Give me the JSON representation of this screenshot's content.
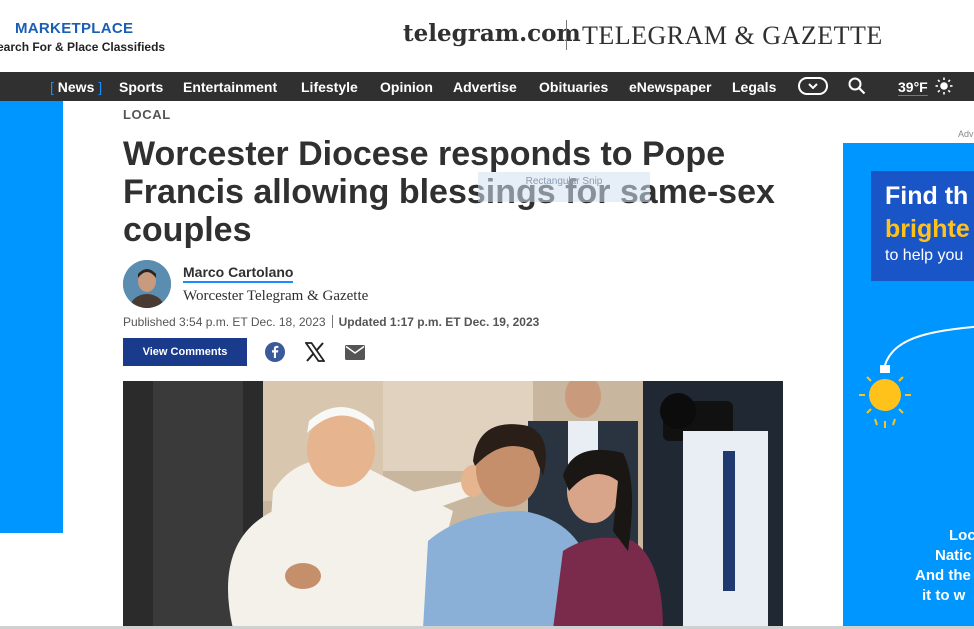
{
  "marketplace": {
    "title": "MARKETPLACE",
    "subtitle": "earch For & Place Classifieds"
  },
  "brand": {
    "site": "telegram.com",
    "paper": "TELEGRAM & GAZETTE"
  },
  "nav": {
    "items": [
      {
        "label": "News",
        "active": true
      },
      {
        "label": "Sports"
      },
      {
        "label": "Entertainment"
      },
      {
        "label": "Lifestyle"
      },
      {
        "label": "Opinion"
      },
      {
        "label": "Advertise"
      },
      {
        "label": "Obituaries"
      },
      {
        "label": "eNewspaper"
      },
      {
        "label": "Legals"
      }
    ],
    "weather": "39°F",
    "accent_color": "#1a8cff",
    "bar_color": "#303030"
  },
  "article": {
    "section": "LOCAL",
    "headline": "Worcester Diocese responds to Pope Francis allowing blessings for same-sex couples",
    "watermark": "Rectangular Snip",
    "author": "Marco Cartolano",
    "organization": "Worcester Telegram & Gazette",
    "published": "Published 3:54 p.m. ET Dec. 18, 2023",
    "updated": "Updated 1:17 p.m. ET Dec. 19, 2023",
    "comments_button": "View Comments",
    "share_icons": [
      "facebook-icon",
      "x-icon",
      "email-icon"
    ],
    "button_color": "#1a3a8c"
  },
  "ad": {
    "label": "Adv",
    "line1": "Find th",
    "line2": "brighte",
    "line3": "to help you",
    "bottom": [
      "Loc",
      "Natic",
      "And the",
      "it to w"
    ],
    "bg_color": "#0096ff",
    "accent_color": "#ffc21a"
  }
}
